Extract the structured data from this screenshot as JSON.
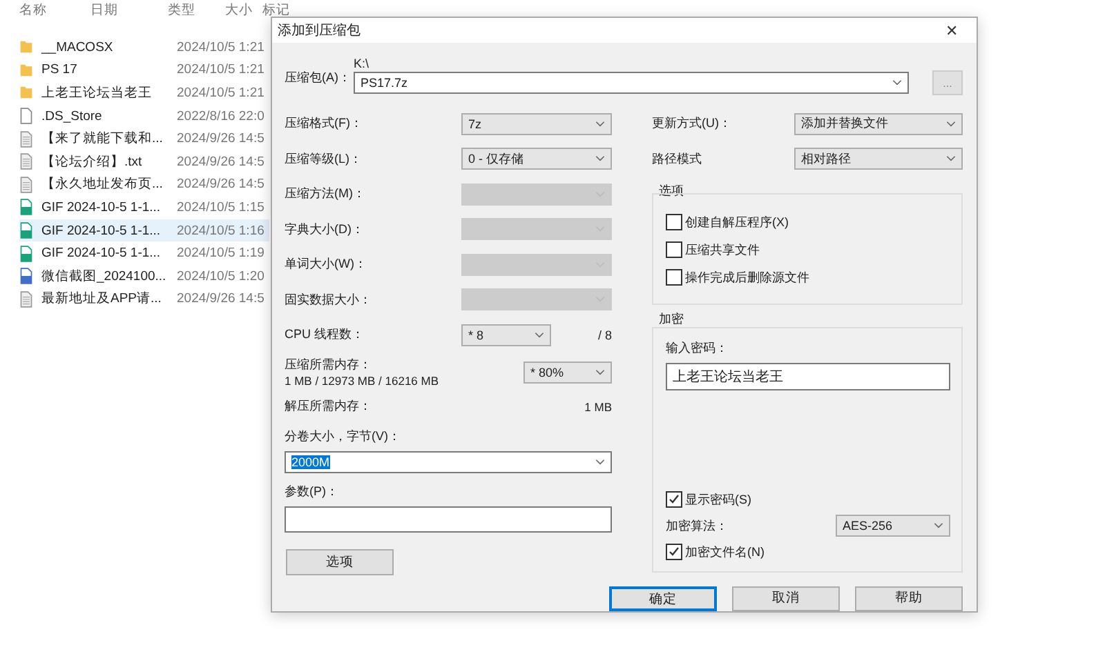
{
  "explorer": {
    "columns": [
      "名称",
      "日期",
      "类型",
      "大小",
      "标记"
    ],
    "files": [
      {
        "name": "__MACOSX",
        "date": "2024/10/5 1:21",
        "kind": "folder",
        "selected": false
      },
      {
        "name": "PS 17",
        "date": "2024/10/5 1:21",
        "kind": "folder",
        "selected": false
      },
      {
        "name": "上老王论坛当老王",
        "date": "2024/10/5 1:21",
        "kind": "folder",
        "selected": false
      },
      {
        "name": ".DS_Store",
        "date": "2022/8/16 22:0",
        "kind": "blank",
        "selected": false
      },
      {
        "name": "【来了就能下载和...",
        "date": "2024/9/26 14:5",
        "kind": "text",
        "selected": false
      },
      {
        "name": "【论坛介绍】.txt",
        "date": "2024/9/26 14:5",
        "kind": "text",
        "selected": false
      },
      {
        "name": "【永久地址发布页...",
        "date": "2024/9/26 14:5",
        "kind": "text",
        "selected": false
      },
      {
        "name": "GIF 2024-10-5 1-1...",
        "date": "2024/10/5 1:15",
        "kind": "gif",
        "selected": false
      },
      {
        "name": "GIF 2024-10-5 1-1...",
        "date": "2024/10/5 1:16",
        "kind": "gif",
        "selected": true
      },
      {
        "name": "GIF 2024-10-5 1-1...",
        "date": "2024/10/5 1:19",
        "kind": "gif",
        "selected": false
      },
      {
        "name": "微信截图_2024100...",
        "date": "2024/10/5 1:20",
        "kind": "image",
        "selected": false
      },
      {
        "name": "最新地址及APP请...",
        "date": "2024/9/26 14:5",
        "kind": "text",
        "selected": false
      }
    ]
  },
  "dialog": {
    "title": "添加到压缩包",
    "close": "✕",
    "archive": {
      "label": "压缩包(A)：",
      "folder": "K:\\",
      "value": "PS17.7z",
      "browse": "..."
    },
    "left_fields": [
      {
        "kind": "select",
        "label": "压缩格式(F)：",
        "value": "7z",
        "disabled": false
      },
      {
        "kind": "select",
        "label": "压缩等级(L)：",
        "value": "0 - 仅存储",
        "disabled": false
      },
      {
        "kind": "select",
        "label": "压缩方法(M)：",
        "disabled": true
      },
      {
        "kind": "select",
        "label": "字典大小(D)：",
        "disabled": true
      },
      {
        "kind": "select",
        "label": "单词大小(W)：",
        "disabled": true
      },
      {
        "kind": "select",
        "label": "固实数据大小：",
        "disabled": true
      },
      {
        "kind": "cpu",
        "label": "CPU 线程数：",
        "value": "* 8",
        "suffix": "/ 8"
      },
      {
        "kind": "memory",
        "label": "压缩所需内存：",
        "detail": "1 MB / 12973 MB / 16216 MB",
        "value": "* 80%"
      },
      {
        "kind": "info",
        "label": "解压所需内存：",
        "value": "1 MB"
      }
    ],
    "volume": {
      "label": "分卷大小，字节(V)：",
      "value": "2000M"
    },
    "params": {
      "label": "参数(P)："
    },
    "options_button": "选项",
    "update": {
      "label": "更新方式(U)：",
      "value": "添加并替换文件"
    },
    "path_mode": {
      "label": "路径模式",
      "value": "相对路径"
    },
    "options_group": {
      "title": "选项",
      "checks": [
        {
          "label": "创建自解压程序(X)",
          "checked": false
        },
        {
          "label": "压缩共享文件",
          "checked": false
        },
        {
          "label": "操作完成后删除源文件",
          "checked": false
        }
      ]
    },
    "encryption": {
      "title": "加密",
      "password_label": "输入密码：",
      "password": "上老王论坛当老王",
      "show_password": {
        "label": "显示密码(S)",
        "checked": true
      },
      "method": {
        "label": "加密算法：",
        "value": "AES-256"
      },
      "encrypt_names": {
        "label": "加密文件名(N)",
        "checked": true
      }
    },
    "buttons": [
      {
        "label": "确定",
        "default": true
      },
      {
        "label": "取消",
        "default": false
      },
      {
        "label": "帮助",
        "default": false
      }
    ]
  }
}
